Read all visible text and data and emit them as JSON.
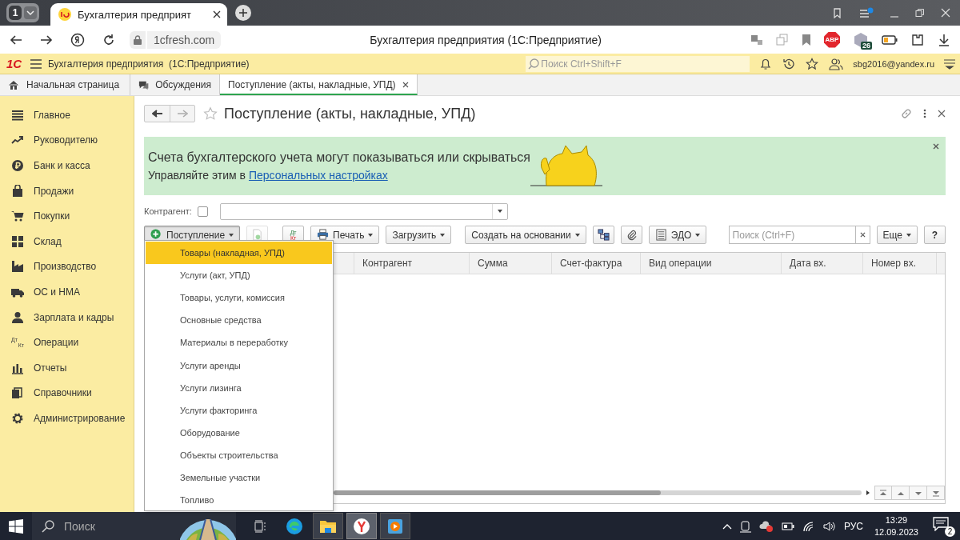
{
  "browser": {
    "tab_count": "1",
    "tabs": [
      {
        "title": "Бухгалтерия предприят",
        "selected": true
      }
    ],
    "url": "1cfresh.com",
    "page_title": "Бухгалтерия предприятия (1С:Предприятие)",
    "adblock": "ABP",
    "extension_badge": "26"
  },
  "app_header": {
    "logo": "1С",
    "title": "Бухгалтерия предприятия  (1С:Предприятие)",
    "search": {
      "placeholder": "Поиск Ctrl+Shift+F"
    },
    "user": "sbg2016@yandex.ru"
  },
  "open_tabs": [
    {
      "label": "Начальная страница",
      "selected": false
    },
    {
      "label": "Обсуждения",
      "selected": false
    },
    {
      "label": "Поступление (акты, накладные, УПД)",
      "selected": true
    }
  ],
  "sidebar": {
    "items": [
      {
        "label": "Главное"
      },
      {
        "label": "Руководителю"
      },
      {
        "label": "Банк и касса"
      },
      {
        "label": "Продажи"
      },
      {
        "label": "Покупки"
      },
      {
        "label": "Склад"
      },
      {
        "label": "Производство"
      },
      {
        "label": "ОС и НМА"
      },
      {
        "label": "Зарплата и кадры"
      },
      {
        "label": "Операции",
        "icon_text": [
          "Дт",
          "Кт"
        ]
      },
      {
        "label": "Отчеты"
      },
      {
        "label": "Справочники"
      },
      {
        "label": "Администрирование"
      }
    ]
  },
  "form": {
    "title": "Поступление (акты, накладные, УПД)",
    "banner": {
      "heading": "Счета бухгалтерского учета могут показываться или скрываться",
      "text": "Управляйте этим в ",
      "link": "Персональных настройках"
    },
    "filter": {
      "label": "Контрагент:",
      "checked": false
    },
    "toolbar": [
      {
        "kind": "add-menu",
        "label": "Поступление",
        "expanded": true,
        "disabled": false
      },
      {
        "kind": "copy",
        "expanded": false,
        "disabled": true
      },
      {
        "kind": "dtkt",
        "lines": [
          "Дт",
          "Кт"
        ],
        "expanded": false,
        "disabled": false
      },
      {
        "kind": "print-menu",
        "label": "Печать",
        "expanded": false,
        "disabled": false
      },
      {
        "kind": "menu",
        "label": "Загрузить",
        "expanded": false,
        "disabled": false
      },
      {
        "kind": "menu",
        "label": "Создать на основании",
        "expanded": false,
        "disabled": false
      },
      {
        "kind": "structure",
        "expanded": false,
        "disabled": false
      },
      {
        "kind": "attach",
        "expanded": false,
        "disabled": false
      },
      {
        "kind": "edo-menu",
        "label": "ЭДО",
        "expanded": false,
        "disabled": false
      }
    ],
    "search": {
      "placeholder": "Поиск (Ctrl+F)"
    },
    "more_button": "Еще",
    "help_button": "?",
    "table": {
      "columns": [
        "Контрагент",
        "Сумма",
        "Счет-фактура",
        "Вид операции",
        "Дата вх.",
        "Номер вх."
      ]
    },
    "dropdown_menu": [
      {
        "label": "Товары (накладная, УПД)",
        "selected": true
      },
      {
        "label": "Услуги (акт, УПД)",
        "selected": false
      },
      {
        "label": "Товары, услуги, комиссия",
        "selected": false
      },
      {
        "label": "Основные средства",
        "selected": false
      },
      {
        "label": "Материалы в переработку",
        "selected": false
      },
      {
        "label": "Услуги аренды",
        "selected": false
      },
      {
        "label": "Услуги лизинга",
        "selected": false
      },
      {
        "label": "Услуги факторинга",
        "selected": false
      },
      {
        "label": "Оборудование",
        "selected": false
      },
      {
        "label": "Объекты строительства",
        "selected": false
      },
      {
        "label": "Земельные участки",
        "selected": false
      },
      {
        "label": "Топливо",
        "selected": false
      }
    ]
  },
  "taskbar": {
    "search_placeholder": "Поиск",
    "language": "РУС",
    "time": "13:29",
    "date": "12.09.2023",
    "notification_count": "2"
  }
}
